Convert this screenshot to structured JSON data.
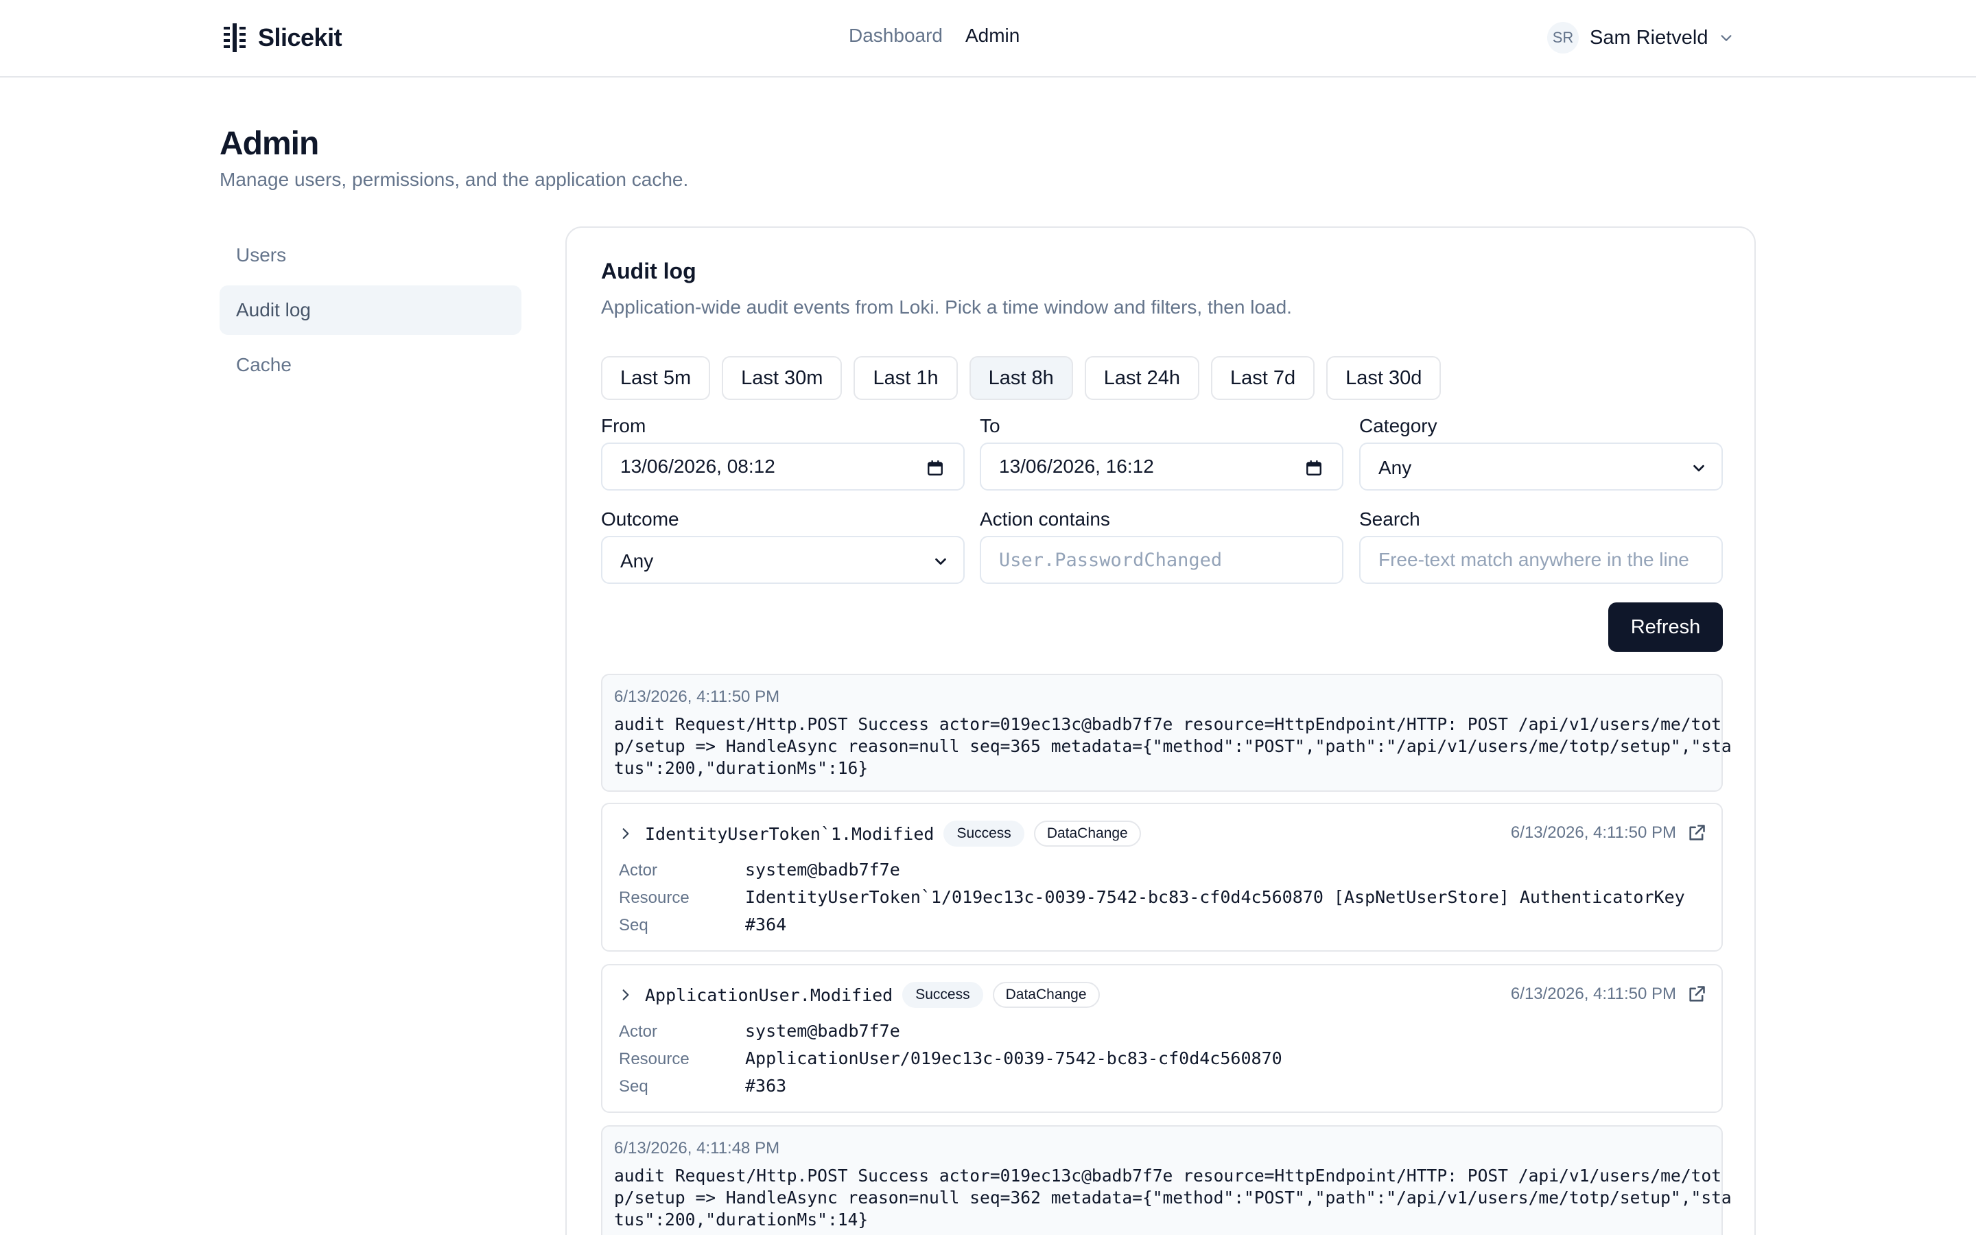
{
  "header": {
    "brand": "Slicekit",
    "nav": [
      {
        "label": "Dashboard",
        "active": false
      },
      {
        "label": "Admin",
        "active": true
      }
    ],
    "user": {
      "initials": "SR",
      "name": "Sam Rietveld"
    }
  },
  "page": {
    "title": "Admin",
    "subtitle": "Manage users, permissions, and the application cache."
  },
  "sidebar": {
    "items": [
      {
        "label": "Users",
        "active": false
      },
      {
        "label": "Audit log",
        "active": true
      },
      {
        "label": "Cache",
        "active": false
      }
    ]
  },
  "audit": {
    "title": "Audit log",
    "subtitle": "Application-wide audit events from Loki. Pick a time window and filters, then load.",
    "ranges": [
      "Last 5m",
      "Last 30m",
      "Last 1h",
      "Last 8h",
      "Last 24h",
      "Last 7d",
      "Last 30d"
    ],
    "selected_range": "Last 8h",
    "filters": {
      "from": {
        "label": "From",
        "value": "13/06/2026, 08:12"
      },
      "to": {
        "label": "To",
        "value": "13/06/2026, 16:12"
      },
      "category": {
        "label": "Category",
        "value": "Any"
      },
      "outcome": {
        "label": "Outcome",
        "value": "Any"
      },
      "action": {
        "label": "Action contains",
        "placeholder": "User.PasswordChanged"
      },
      "search": {
        "label": "Search",
        "placeholder": "Free-text match anywhere in the line"
      }
    },
    "refresh_label": "Refresh",
    "entries": [
      {
        "kind": "raw",
        "time": "6/13/2026, 4:11:50 PM",
        "lines": [
          "audit Request/Http.POST Success actor=019ec13c@badb7f7e resource=HttpEndpoint/HTTP: POST /api/v1/users/me/tot",
          "p/setup => HandleAsync reason=null seq=365 metadata={\"method\":\"POST\",\"path\":\"/api/v1/users/me/totp/setup\",\"sta",
          "tus\":200,\"durationMs\":16}"
        ]
      },
      {
        "kind": "event",
        "action": "IdentityUserToken`1.Modified",
        "outcome": "Success",
        "category": "DataChange",
        "time": "6/13/2026, 4:11:50 PM",
        "actor_label": "Actor",
        "actor": "system@badb7f7e",
        "resource_label": "Resource",
        "resource": "IdentityUserToken`1/019ec13c-0039-7542-bc83-cf0d4c560870 [AspNetUserStore] AuthenticatorKey",
        "seq_label": "Seq",
        "seq": "#364"
      },
      {
        "kind": "event",
        "action": "ApplicationUser.Modified",
        "outcome": "Success",
        "category": "DataChange",
        "time": "6/13/2026, 4:11:50 PM",
        "actor_label": "Actor",
        "actor": "system@badb7f7e",
        "resource_label": "Resource",
        "resource": "ApplicationUser/019ec13c-0039-7542-bc83-cf0d4c560870",
        "seq_label": "Seq",
        "seq": "#363"
      },
      {
        "kind": "raw",
        "time": "6/13/2026, 4:11:48 PM",
        "lines": [
          "audit Request/Http.POST Success actor=019ec13c@badb7f7e resource=HttpEndpoint/HTTP: POST /api/v1/users/me/tot",
          "p/setup => HandleAsync reason=null seq=362 metadata={\"method\":\"POST\",\"path\":\"/api/v1/users/me/totp/setup\",\"sta",
          "tus\":200,\"durationMs\":14}"
        ]
      }
    ]
  },
  "colors": {
    "primary": "#0f172a",
    "muted": "#64748b",
    "border": "#e5e7eb",
    "subtle_bg": "#f1f5f9"
  }
}
